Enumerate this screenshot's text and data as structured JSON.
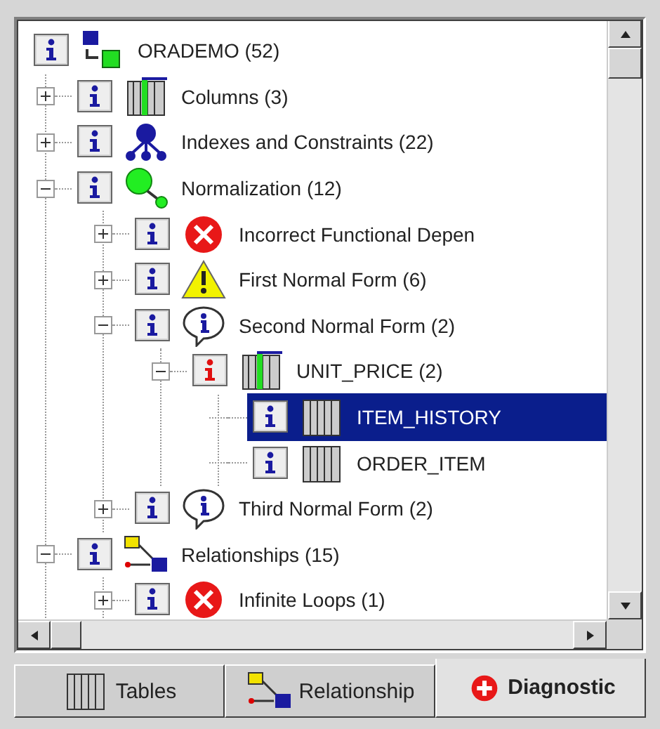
{
  "tree": {
    "label": "ORADEMO (52)",
    "kind": "database",
    "flagged": false,
    "selected": false,
    "children": [
      {
        "label": "Columns (3)",
        "kind": "columns",
        "flagged": false,
        "selected": false,
        "expanded": false
      },
      {
        "label": "Indexes and Constraints (22)",
        "kind": "index",
        "flagged": false,
        "selected": false,
        "expanded": false
      },
      {
        "label": "Normalization (12)",
        "kind": "normalization",
        "flagged": false,
        "selected": false,
        "expanded": true,
        "children": [
          {
            "label": "Incorrect Functional Depen",
            "kind": "error",
            "flagged": false,
            "selected": false,
            "expanded": false
          },
          {
            "label": "First Normal Form (6)",
            "kind": "warning",
            "flagged": false,
            "selected": false,
            "expanded": false
          },
          {
            "label": "Second Normal Form (2)",
            "kind": "info",
            "flagged": false,
            "selected": false,
            "expanded": true,
            "children": [
              {
                "label": "UNIT_PRICE (2)",
                "kind": "column",
                "flagged": true,
                "selected": false,
                "expanded": true,
                "children": [
                  {
                    "label": "ITEM_HISTORY",
                    "kind": "table",
                    "flagged": false,
                    "selected": true
                  },
                  {
                    "label": "ORDER_ITEM",
                    "kind": "table",
                    "flagged": false,
                    "selected": false
                  }
                ]
              }
            ]
          },
          {
            "label": "Third Normal Form (2)",
            "kind": "info",
            "flagged": false,
            "selected": false,
            "expanded": false
          }
        ]
      },
      {
        "label": "Relationships (15)",
        "kind": "relationships",
        "flagged": false,
        "selected": false,
        "expanded": true,
        "children": [
          {
            "label": "Infinite Loops (1)",
            "kind": "error",
            "flagged": false,
            "selected": false,
            "expanded": false
          }
        ]
      }
    ]
  },
  "tabs": [
    {
      "label": "Tables",
      "kind": "table",
      "selected": false
    },
    {
      "label": "Relationship",
      "kind": "relationships",
      "selected": false
    },
    {
      "label": "Diagnostic",
      "kind": "diagnostic",
      "selected": true
    }
  ]
}
